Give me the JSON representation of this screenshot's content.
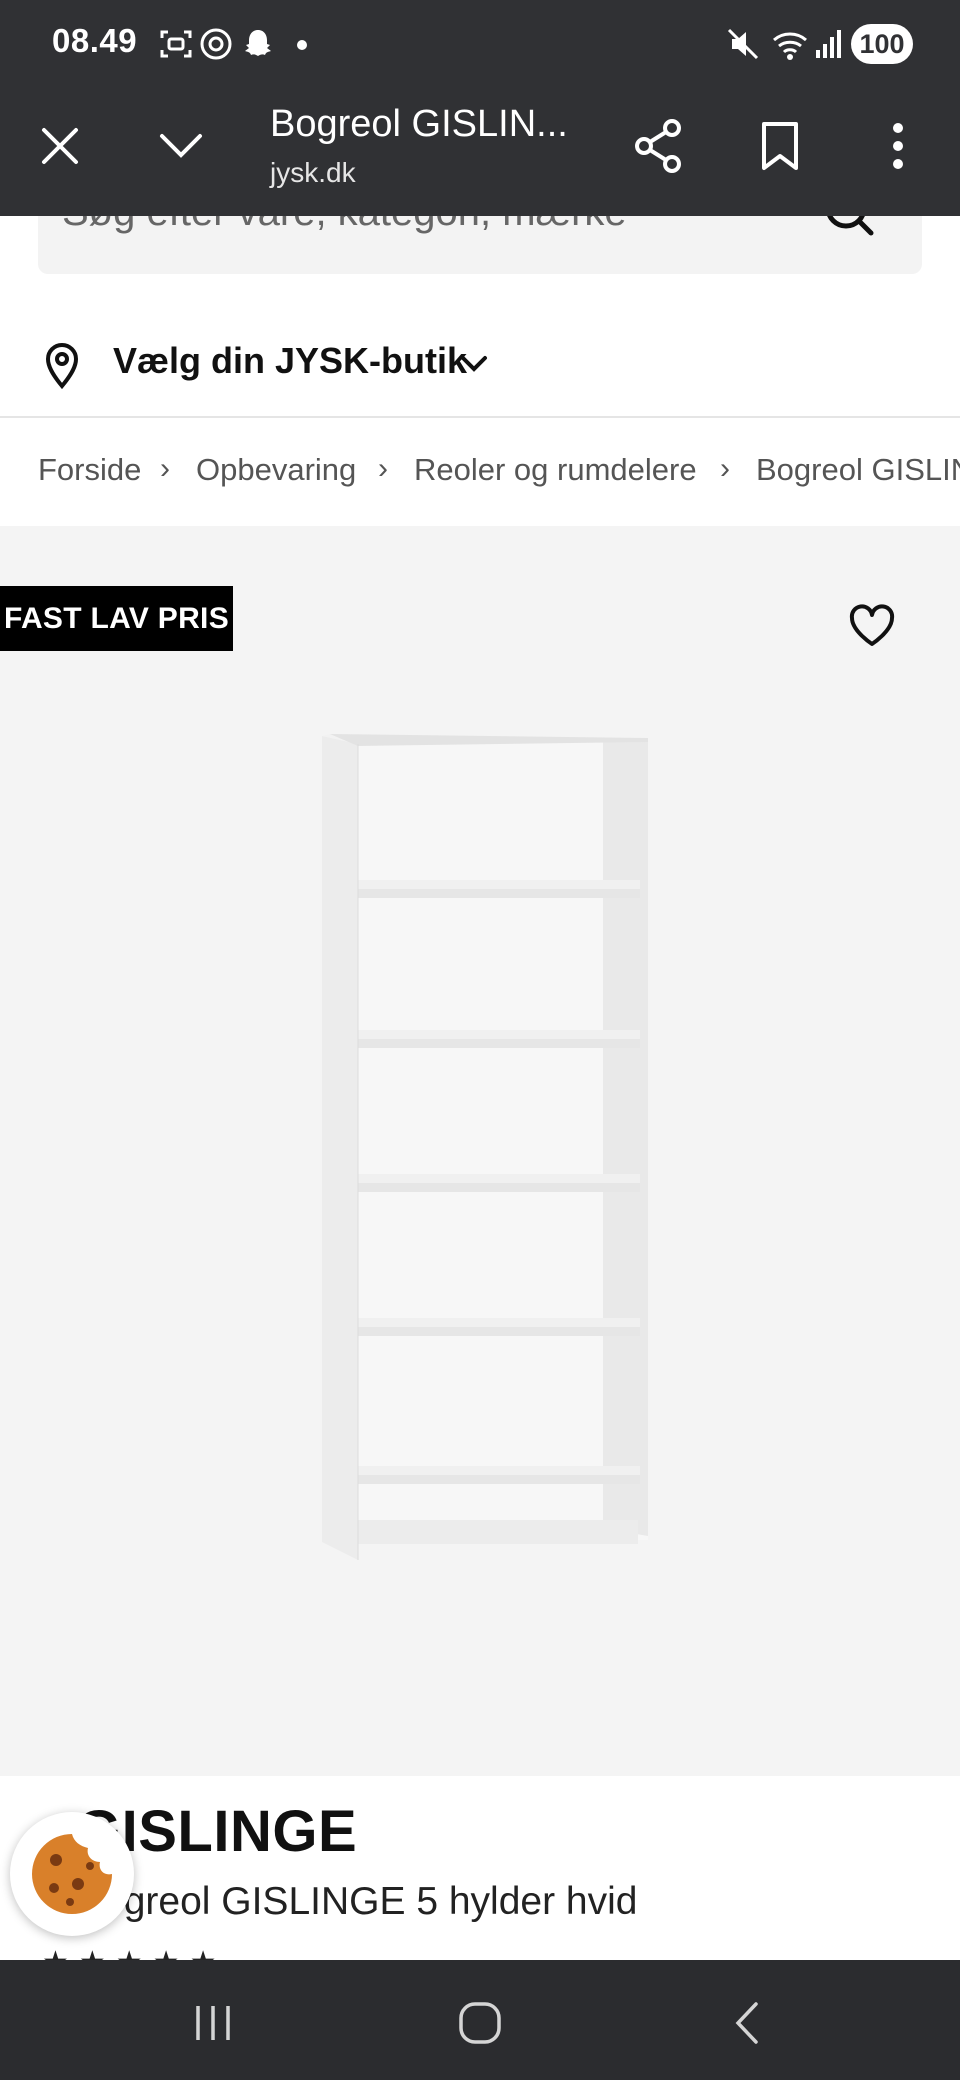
{
  "status_bar": {
    "time": "08.49",
    "battery": "100",
    "icons": [
      "screenshot-icon",
      "threads-icon",
      "snapchat-icon",
      "dot-icon",
      "mute-icon",
      "wifi-icon",
      "signal-icon"
    ]
  },
  "browser": {
    "title": "Bogreol GISLIN...",
    "domain": "jysk.dk",
    "icons": [
      "close-icon",
      "chevron-down-icon",
      "share-icon",
      "bookmark-icon",
      "more-icon"
    ]
  },
  "search": {
    "placeholder": "Søg efter vare, kategori, mærke"
  },
  "store": {
    "label": "Vælg din JYSK-butik"
  },
  "breadcrumb": [
    "Forside",
    "Opbevaring",
    "Reoler og rumdelere",
    "Bogreol GISLINGE"
  ],
  "product": {
    "badge": "FAST LAV PRIS",
    "name": "GISLINGE",
    "subtitle": "Bogreol GISLINGE 5 hylder hvid",
    "rating_stars": "★★★★★",
    "image_icon": "bookshelf-image"
  },
  "colors": {
    "dark_bar": "#303134",
    "badge_bg": "#000000",
    "product_bg": "#f4f4f4",
    "cookie": "#d9802a"
  }
}
